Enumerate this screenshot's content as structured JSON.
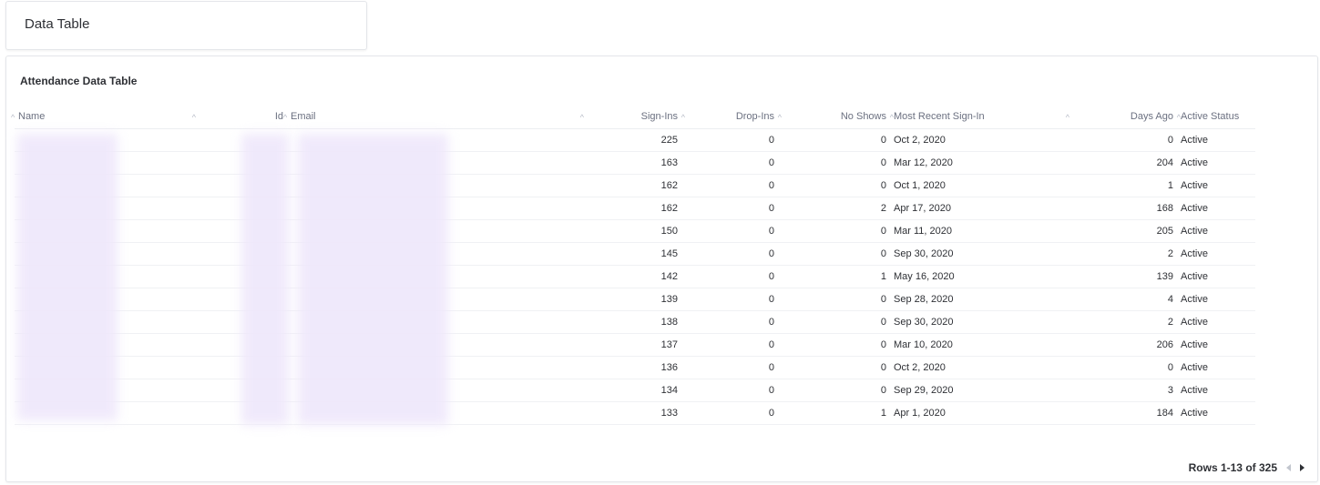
{
  "title_card": {
    "title": "Data Table"
  },
  "table_card": {
    "title": "Attendance Data Table",
    "columns": {
      "name": "Name",
      "id": "Id",
      "email": "Email",
      "sign_ins": "Sign-Ins",
      "drop_ins": "Drop-Ins",
      "no_shows": "No Shows",
      "most_recent": "Most Recent Sign-In",
      "days_ago": "Days Ago",
      "active_status": "Active Status"
    },
    "rows": [
      {
        "sign_ins": "225",
        "drop_ins": "0",
        "no_shows": "0",
        "most_recent": "Oct 2, 2020",
        "days_ago": "0",
        "status": "Active"
      },
      {
        "sign_ins": "163",
        "drop_ins": "0",
        "no_shows": "0",
        "most_recent": "Mar 12, 2020",
        "days_ago": "204",
        "status": "Active"
      },
      {
        "sign_ins": "162",
        "drop_ins": "0",
        "no_shows": "0",
        "most_recent": "Oct 1, 2020",
        "days_ago": "1",
        "status": "Active"
      },
      {
        "sign_ins": "162",
        "drop_ins": "0",
        "no_shows": "2",
        "most_recent": "Apr 17, 2020",
        "days_ago": "168",
        "status": "Active"
      },
      {
        "sign_ins": "150",
        "drop_ins": "0",
        "no_shows": "0",
        "most_recent": "Mar 11, 2020",
        "days_ago": "205",
        "status": "Active"
      },
      {
        "sign_ins": "145",
        "drop_ins": "0",
        "no_shows": "0",
        "most_recent": "Sep 30, 2020",
        "days_ago": "2",
        "status": "Active"
      },
      {
        "sign_ins": "142",
        "drop_ins": "0",
        "no_shows": "1",
        "most_recent": "May 16, 2020",
        "days_ago": "139",
        "status": "Active"
      },
      {
        "sign_ins": "139",
        "drop_ins": "0",
        "no_shows": "0",
        "most_recent": "Sep 28, 2020",
        "days_ago": "4",
        "status": "Active"
      },
      {
        "sign_ins": "138",
        "drop_ins": "0",
        "no_shows": "0",
        "most_recent": "Sep 30, 2020",
        "days_ago": "2",
        "status": "Active"
      },
      {
        "sign_ins": "137",
        "drop_ins": "0",
        "no_shows": "0",
        "most_recent": "Mar 10, 2020",
        "days_ago": "206",
        "status": "Active"
      },
      {
        "sign_ins": "136",
        "drop_ins": "0",
        "no_shows": "0",
        "most_recent": "Oct 2, 2020",
        "days_ago": "0",
        "status": "Active"
      },
      {
        "sign_ins": "134",
        "drop_ins": "0",
        "no_shows": "0",
        "most_recent": "Sep 29, 2020",
        "days_ago": "3",
        "status": "Active"
      },
      {
        "sign_ins": "133",
        "drop_ins": "0",
        "no_shows": "1",
        "most_recent": "Apr 1, 2020",
        "days_ago": "184",
        "status": "Active"
      }
    ],
    "pagination": {
      "label": "Rows 1-13 of 325"
    }
  },
  "icons": {
    "sort": "sort-arrow-icon",
    "prev": "chevron-left-icon",
    "next": "chevron-right-icon"
  },
  "colors": {
    "redaction": "#efe8fb",
    "text": "#2e3035",
    "header_text": "#6b7080"
  }
}
